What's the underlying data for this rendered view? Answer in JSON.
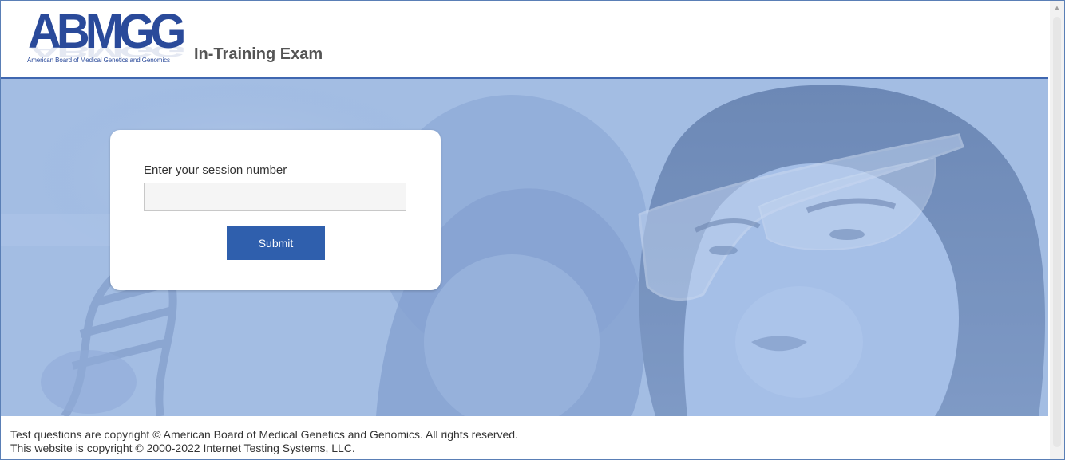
{
  "header": {
    "logo_text": "ABMGG",
    "logo_subtitle": "American Board of Medical Genetics and Genomics",
    "title": "In-Training Exam"
  },
  "login": {
    "label": "Enter your session number",
    "input_value": "",
    "input_placeholder": "",
    "submit_label": "Submit"
  },
  "footer": {
    "line1": "Test questions are copyright © American Board of Medical Genetics and Genomics. All rights reserved.",
    "line2": "This website is copyright © 2000-2022 Internet Testing Systems, LLC."
  },
  "colors": {
    "brand": "#2a4a9a",
    "accent": "#2f5fad",
    "hero_tint": "#9cb7e0"
  },
  "icons": {
    "scroll_up": "scroll-up-arrow-icon"
  }
}
